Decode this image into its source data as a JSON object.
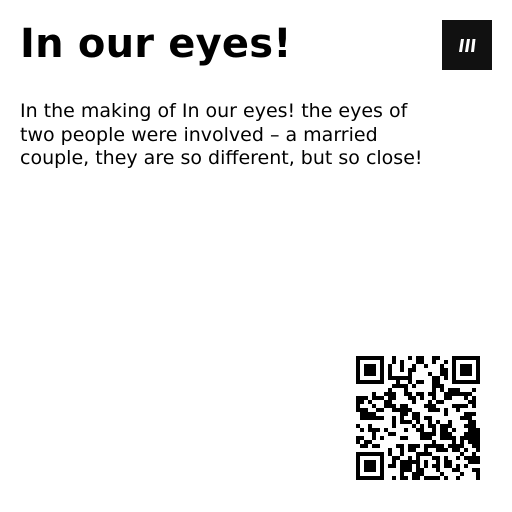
{
  "card": {
    "title": "In our eyes!",
    "description": "In the making of In our eyes! the eyes of two people were involved – a married couple, they are so different, but so close!"
  },
  "icons": {
    "logo": "brand-logo-icon",
    "qr": "qr-code-icon"
  },
  "colors": {
    "background": "#ffffff",
    "text": "#000000",
    "logo_bg": "#111111"
  }
}
